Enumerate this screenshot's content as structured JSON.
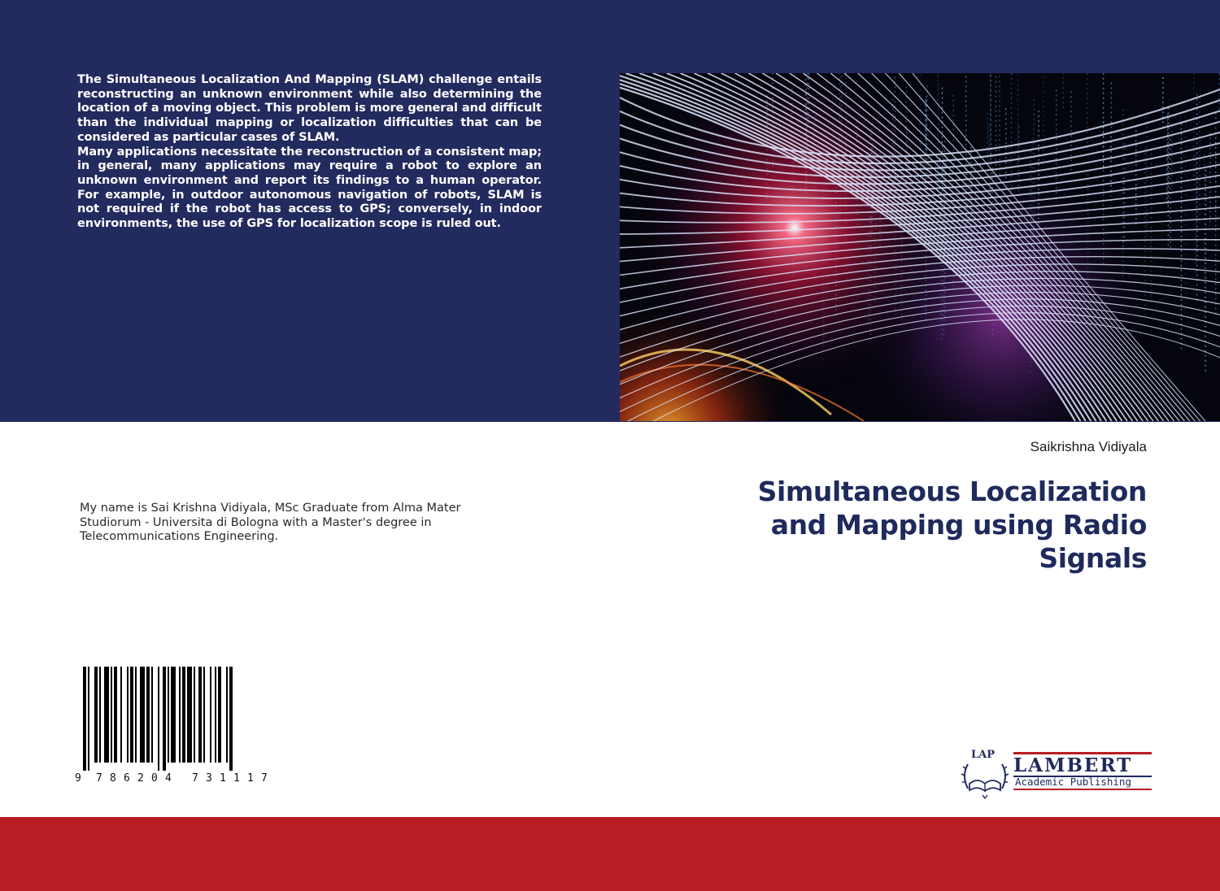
{
  "back_cover": {
    "blurb_paragraph_1": "The Simultaneous Localization And Mapping (SLAM) challenge entails reconstructing an unknown environment while also determining the location of a moving object. This problem is more general and difficult than the individual mapping or localization difficulties that can be considered as particular cases of SLAM.",
    "blurb_paragraph_2": "Many applications necessitate the reconstruction of a consistent map; in general, many applications may require a robot to explore an unknown environment and report its findings to a human operator. For example, in outdoor autonomous navigation of robots, SLAM is not required if the robot has access to GPS; conversely, in indoor environments, the use of GPS for localization scope is ruled out.",
    "author_bio": "My name is Sai Krishna Vidiyala, MSc Graduate from Alma Mater Studiorum - Universita di Bologna with a Master's degree in Telecommunications Engineering.",
    "barcode": {
      "digits": [
        "9",
        "7",
        "8",
        "6",
        "2",
        "0",
        "4",
        "7",
        "3",
        "1",
        "1",
        "1",
        "7"
      ]
    }
  },
  "front_cover": {
    "author": "Saikrishna Vidiyala",
    "title_lines": [
      "Simultaneous Localization",
      "and Mapping using Radio",
      "Signals"
    ],
    "cover_image_icon": "abstract-light-grid-image"
  },
  "publisher": {
    "emblem_letters": "LAP",
    "name": "LAMBERT",
    "subtitle": "Academic Publishing",
    "emblem_icon": "open-book-laurel-icon"
  },
  "colors": {
    "top_band": "#232a5e",
    "bottom_band": "#b81d24",
    "title_text": "#1f2a5c",
    "white": "#ffffff"
  }
}
